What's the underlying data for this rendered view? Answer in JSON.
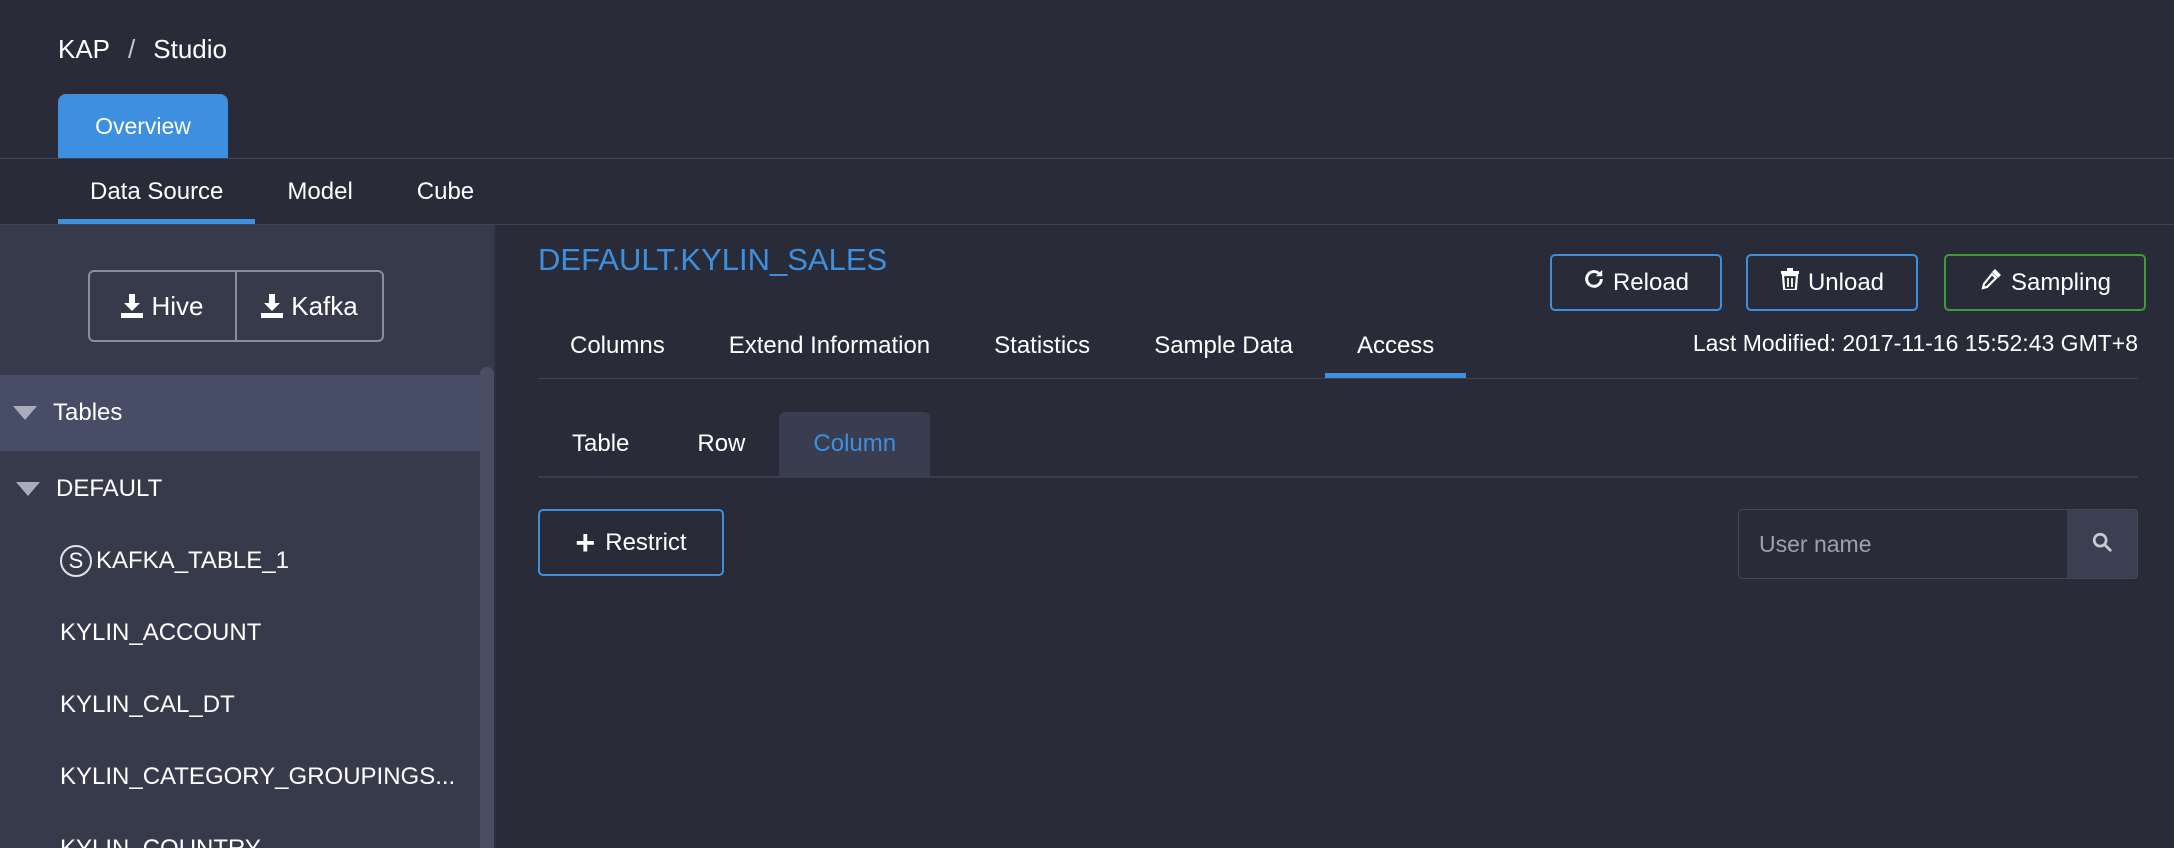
{
  "breadcrumb": {
    "root": "KAP",
    "separator": "/",
    "current": "Studio"
  },
  "top_tab": {
    "label": "Overview"
  },
  "subnav": {
    "items": [
      "Data Source",
      "Model",
      "Cube"
    ],
    "active": "Data Source"
  },
  "sidebar": {
    "load_buttons": {
      "hive": "Hive",
      "kafka": "Kafka"
    },
    "tree": {
      "root_label": "Tables",
      "database": "DEFAULT",
      "streaming_badge": "S",
      "tables": [
        "KAFKA_TABLE_1",
        "KYLIN_ACCOUNT",
        "KYLIN_CAL_DT",
        "KYLIN_CATEGORY_GROUPINGS...",
        "KYLIN_COUNTRY"
      ]
    }
  },
  "content": {
    "title": "DEFAULT.KYLIN_SALES",
    "actions": {
      "reload": "Reload",
      "unload": "Unload",
      "sampling": "Sampling"
    },
    "tabs": [
      "Columns",
      "Extend Information",
      "Statistics",
      "Sample Data",
      "Access"
    ],
    "active_tab": "Access",
    "last_modified": "Last Modified: 2017-11-16 15:52:43 GMT+8",
    "access_tabs": [
      "Table",
      "Row",
      "Column"
    ],
    "active_access_tab": "Column",
    "restrict_button": "Restrict",
    "search": {
      "placeholder": "User name",
      "value": ""
    }
  },
  "colors": {
    "accent": "#3d8fe0",
    "success": "#3f9a3a",
    "background": "#292c38",
    "sidebar": "#373a4b"
  },
  "icons": {
    "reload": "refresh-icon",
    "unload": "trash-icon",
    "sampling": "eyedropper-icon",
    "load": "download-icon",
    "search": "search-icon"
  }
}
